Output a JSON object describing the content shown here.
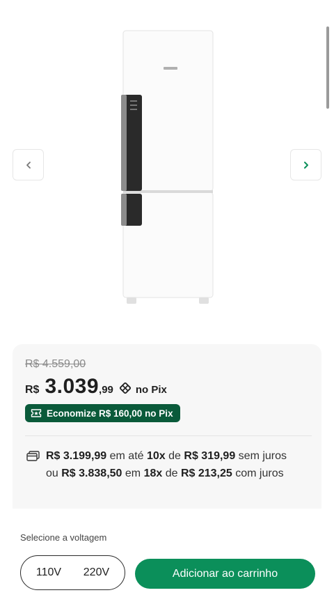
{
  "gallery": {
    "prev_icon": "chevron-left-icon",
    "next_icon": "chevron-right-icon",
    "image_alt": "Geladeira"
  },
  "price": {
    "old_price": "R$ 4.559,00",
    "currency": "R$",
    "main": "3.039",
    "cents": ",99",
    "pix_icon": "pix-icon",
    "pix_label": "no Pix",
    "economize": "Economize R$ 160,00 no Pix",
    "economize_icon": "ticket-icon"
  },
  "installments": [
    {
      "icon": "card-icon",
      "total": "R$ 3.199,99",
      "text1": " em até ",
      "count": "10x",
      "text2": " de ",
      "each": "R$ 319,99",
      "text3": " sem juros"
    },
    {
      "prefix": "ou ",
      "total": "R$ 3.838,50",
      "text1": " em ",
      "count": "18x",
      "text2": " de ",
      "each": "R$ 213,25",
      "text3": " com juros"
    }
  ],
  "purchase": {
    "voltage_label": "Selecione a voltagem",
    "voltage_options": [
      "110V",
      "220V"
    ],
    "add_to_cart": "Adicionar ao carrinho"
  },
  "colors": {
    "accent_green": "#0b8f5a",
    "badge_green": "#0a5a3a"
  }
}
